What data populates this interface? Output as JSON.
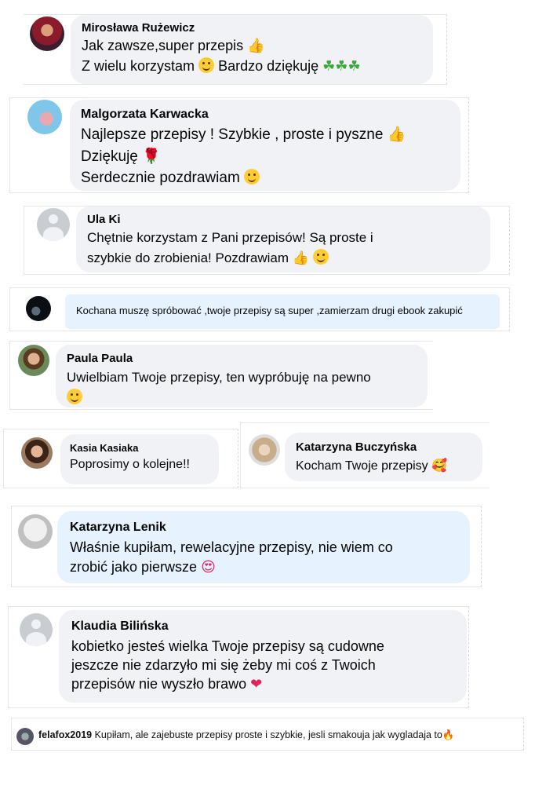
{
  "comments": [
    {
      "name": "Mirosława Rużewicz",
      "lines": [
        "Jak zawsze,super przepis",
        "Z wielu korzystam",
        "Bardzo dziękuję"
      ]
    },
    {
      "name": "Malgorzata Karwacka",
      "lines": [
        "Najlepsze przepisy ! Szybkie , proste i pyszne",
        "Dziękuję",
        "Serdecznie pozdrawiam"
      ]
    },
    {
      "name": "Ula Ki",
      "lines": [
        "Chętnie korzystam z Pani przepisów! Są proste i",
        "szybkie do zrobienia! Pozdrawiam"
      ]
    },
    {
      "name": "",
      "lines": [
        "Kochana muszę spróbować ,twoje przepisy są super ,zamierzam drugi ebook zakupić"
      ]
    },
    {
      "name": "Paula Paula",
      "lines": [
        "Uwielbiam Twoje przepisy, ten wypróbuję na pewno"
      ]
    },
    {
      "name": "Kasia Kasiaka",
      "lines": [
        "Poprosimy o kolejne!!"
      ]
    },
    {
      "name": "Katarzyna Buczyńska",
      "lines": [
        "Kocham Twoje przepisy"
      ]
    },
    {
      "name": "Katarzyna Lenik",
      "lines": [
        "Właśnie kupiłam, rewelacyjne przepisy, nie wiem co",
        "zrobić jako pierwsze"
      ]
    },
    {
      "name": "Klaudia Bilińska",
      "lines": [
        "kobietko jesteś wielka Twoje przepisy są cudowne",
        "jeszcze nie zdarzyło mi się żeby mi coś z Twoich",
        "przepisów nie wyszło brawo"
      ]
    },
    {
      "name": "felafox2019",
      "lines": [
        "Kupiłam, ale zajebuste przepisy proste i szybkie, jesli smakouja jak wygladaja to"
      ]
    }
  ],
  "emoji": {
    "thumbs": "👍",
    "clover": "☘",
    "rose": "🌹",
    "heart": "❤",
    "fire": "🔥",
    "love_eyes": "😍",
    "love_face": "🥰"
  },
  "colors": {
    "bubble": "#f0f2f5",
    "bubble_blue": "#e6f2fd",
    "fire": "#ff6a00",
    "heart": "#e0245e"
  }
}
